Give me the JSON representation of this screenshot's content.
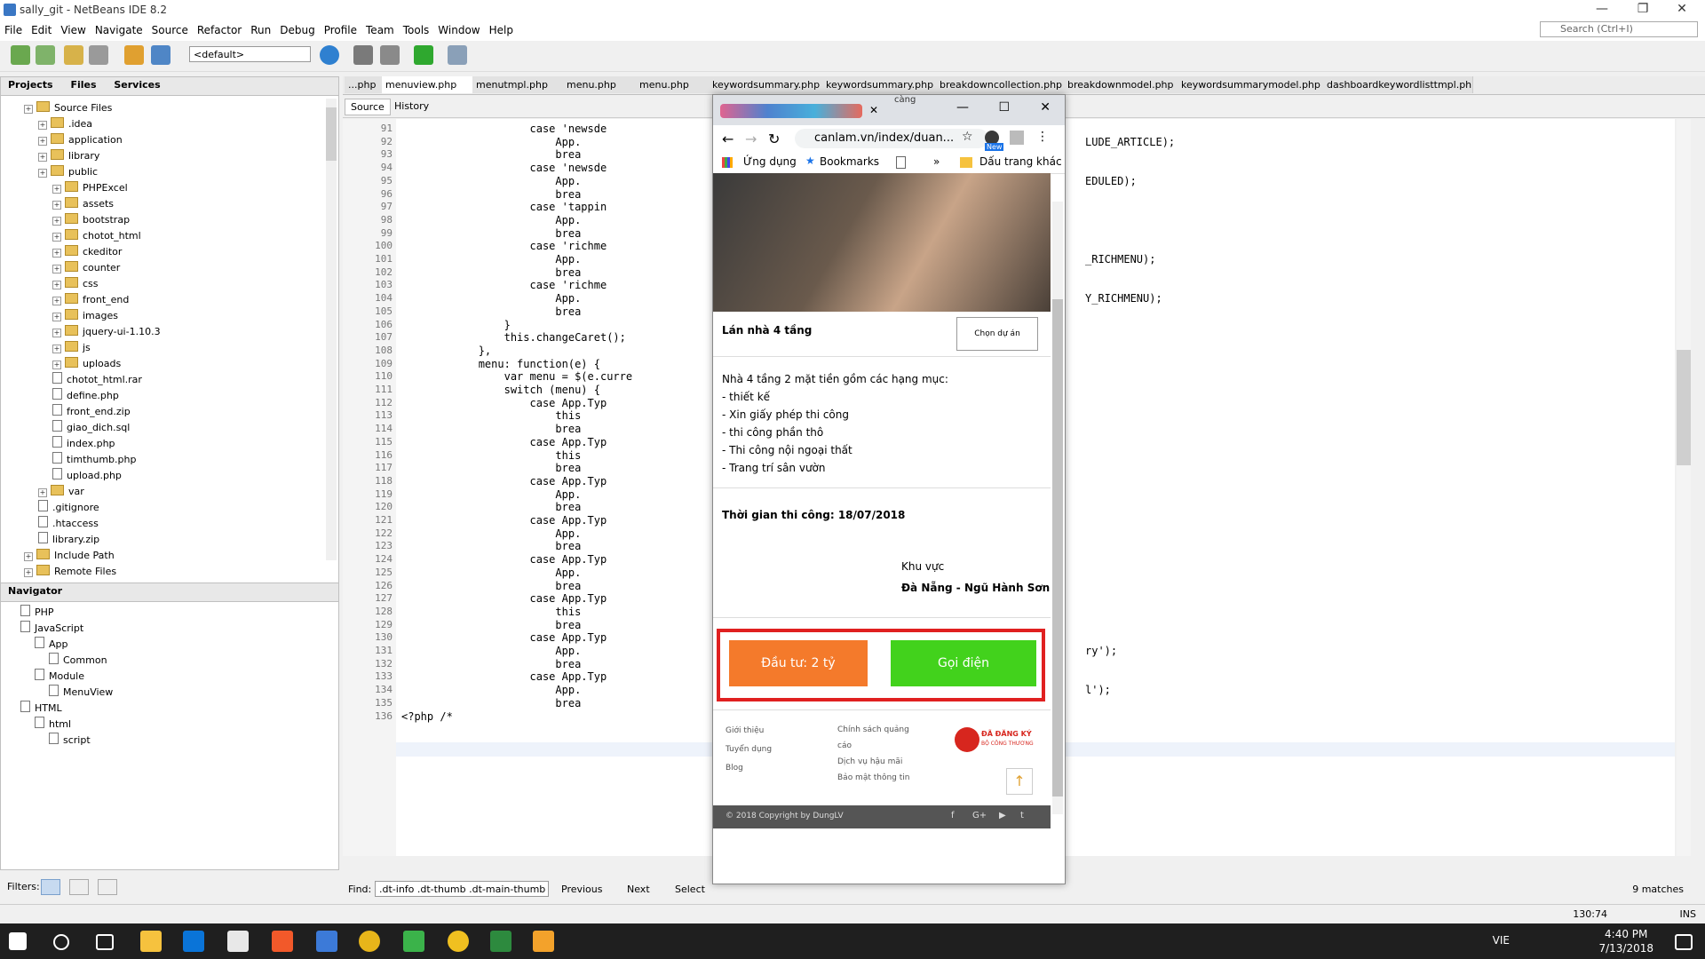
{
  "window": {
    "title": "sally_git - NetBeans IDE 8.2"
  },
  "menu": [
    "File",
    "Edit",
    "View",
    "Navigate",
    "Source",
    "Refactor",
    "Run",
    "Debug",
    "Profile",
    "Team",
    "Tools",
    "Window",
    "Help"
  ],
  "search": {
    "placeholder": "Search (Ctrl+I)"
  },
  "toolbar": {
    "config": "<default>"
  },
  "projects_panel": {
    "tabs": [
      "Projects",
      "Files",
      "Services"
    ],
    "tree": [
      {
        "label": "Source Files",
        "kind": "folder",
        "indent": 1
      },
      {
        "label": ".idea",
        "kind": "folder",
        "indent": 2
      },
      {
        "label": "application",
        "kind": "folder",
        "indent": 2
      },
      {
        "label": "library",
        "kind": "folder",
        "indent": 2
      },
      {
        "label": "public",
        "kind": "folder",
        "indent": 2
      },
      {
        "label": "PHPExcel",
        "kind": "folder",
        "indent": 3
      },
      {
        "label": "assets",
        "kind": "folder",
        "indent": 3
      },
      {
        "label": "bootstrap",
        "kind": "folder",
        "indent": 3
      },
      {
        "label": "chotot_html",
        "kind": "folder",
        "indent": 3
      },
      {
        "label": "ckeditor",
        "kind": "folder",
        "indent": 3
      },
      {
        "label": "counter",
        "kind": "folder",
        "indent": 3
      },
      {
        "label": "css",
        "kind": "folder",
        "indent": 3
      },
      {
        "label": "front_end",
        "kind": "folder",
        "indent": 3
      },
      {
        "label": "images",
        "kind": "folder",
        "indent": 3
      },
      {
        "label": "jquery-ui-1.10.3",
        "kind": "folder",
        "indent": 3
      },
      {
        "label": "js",
        "kind": "folder",
        "indent": 3
      },
      {
        "label": "uploads",
        "kind": "folder",
        "indent": 3
      },
      {
        "label": "chotot_html.rar",
        "kind": "file",
        "indent": 3
      },
      {
        "label": "define.php",
        "kind": "file",
        "indent": 3
      },
      {
        "label": "front_end.zip",
        "kind": "file",
        "indent": 3
      },
      {
        "label": "giao_dich.sql",
        "kind": "file",
        "indent": 3
      },
      {
        "label": "index.php",
        "kind": "file",
        "indent": 3
      },
      {
        "label": "timthumb.php",
        "kind": "file",
        "indent": 3
      },
      {
        "label": "upload.php",
        "kind": "file",
        "indent": 3
      },
      {
        "label": "var",
        "kind": "folder",
        "indent": 2
      },
      {
        "label": ".gitignore",
        "kind": "file",
        "indent": 2
      },
      {
        "label": ".htaccess",
        "kind": "file",
        "indent": 2
      },
      {
        "label": "library.zip",
        "kind": "file",
        "indent": 2
      },
      {
        "label": "Include Path",
        "kind": "folder",
        "indent": 1
      },
      {
        "label": "Remote Files",
        "kind": "folder",
        "indent": 1
      }
    ]
  },
  "navigator": {
    "title": "Navigator",
    "tree": [
      {
        "label": "PHP",
        "indent": 1
      },
      {
        "label": "JavaScript",
        "indent": 1
      },
      {
        "label": "App",
        "indent": 2
      },
      {
        "label": "Common",
        "indent": 3
      },
      {
        "label": "Module",
        "indent": 2
      },
      {
        "label": "MenuView",
        "indent": 3
      },
      {
        "label": "HTML",
        "indent": 1
      },
      {
        "label": "html",
        "indent": 2
      },
      {
        "label": "script",
        "indent": 3
      }
    ]
  },
  "filters_label": "Filters:",
  "editor": {
    "tabs": [
      "...php",
      "menuview.php",
      "menutmpl.php",
      "menu.php",
      "menu.php",
      "keywordsummary.php",
      "keywordsummary.php",
      "breakdowncollection.php",
      "breakdownmodel.php",
      "keywordsummarymodel.php",
      "dashboardkeywordlisttmpl.php..."
    ],
    "source_tab": "Source",
    "history_tab": "History",
    "lines": [
      {
        "n": "91",
        "code": "                    case 'newsde",
        "right": ""
      },
      {
        "n": "92",
        "code": "                        App.",
        "right": "LUDE_ARTICLE);"
      },
      {
        "n": "93",
        "code": "                        brea",
        "right": ""
      },
      {
        "n": "94",
        "code": "                    case 'newsde",
        "right": ""
      },
      {
        "n": "95",
        "code": "                        App.",
        "right": "EDULED);"
      },
      {
        "n": "96",
        "code": "                        brea",
        "right": ""
      },
      {
        "n": "97",
        "code": "                    case 'tappin",
        "right": ""
      },
      {
        "n": "98",
        "code": "                        App.",
        "right": ""
      },
      {
        "n": "99",
        "code": "                        brea",
        "right": ""
      },
      {
        "n": "100",
        "code": "                    case 'richme",
        "right": ""
      },
      {
        "n": "101",
        "code": "                        App.",
        "right": "_RICHMENU);"
      },
      {
        "n": "102",
        "code": "                        brea",
        "right": ""
      },
      {
        "n": "103",
        "code": "                    case 'richme",
        "right": ""
      },
      {
        "n": "104",
        "code": "                        App.",
        "right": "Y_RICHMENU);"
      },
      {
        "n": "105",
        "code": "                        brea",
        "right": ""
      },
      {
        "n": "106",
        "code": "                }",
        "right": ""
      },
      {
        "n": "107",
        "code": "                this.changeCaret();",
        "right": ""
      },
      {
        "n": "108",
        "code": "            },",
        "right": ""
      },
      {
        "n": "109",
        "code": "            menu: function(e) {",
        "right": ""
      },
      {
        "n": "110",
        "code": "                var menu = $(e.curre",
        "right": ""
      },
      {
        "n": "111",
        "code": "                switch (menu) {",
        "right": ""
      },
      {
        "n": "112",
        "code": "                    case App.Typ",
        "right": ""
      },
      {
        "n": "113",
        "code": "                        this",
        "right": ""
      },
      {
        "n": "114",
        "code": "                        brea",
        "right": ""
      },
      {
        "n": "115",
        "code": "                    case App.Typ",
        "right": ""
      },
      {
        "n": "116",
        "code": "                        this",
        "right": ""
      },
      {
        "n": "117",
        "code": "                        brea",
        "right": ""
      },
      {
        "n": "118",
        "code": "                    case App.Typ",
        "right": ""
      },
      {
        "n": "119",
        "code": "                        App.",
        "right": ""
      },
      {
        "n": "120",
        "code": "                        brea",
        "right": ""
      },
      {
        "n": "121",
        "code": "                    case App.Typ",
        "right": ""
      },
      {
        "n": "122",
        "code": "                        App.",
        "right": ""
      },
      {
        "n": "123",
        "code": "                        brea",
        "right": ""
      },
      {
        "n": "124",
        "code": "                    case App.Typ",
        "right": ""
      },
      {
        "n": "125",
        "code": "                        App.",
        "right": ""
      },
      {
        "n": "126",
        "code": "                        brea",
        "right": ""
      },
      {
        "n": "127",
        "code": "                    case App.Typ",
        "right": ""
      },
      {
        "n": "128",
        "code": "                        this",
        "right": ""
      },
      {
        "n": "129",
        "code": "                        brea",
        "right": ""
      },
      {
        "n": "130",
        "code": "                    case App.Typ",
        "right": ""
      },
      {
        "n": "131",
        "code": "                        App.",
        "right": "ry');"
      },
      {
        "n": "132",
        "code": "                        brea",
        "right": ""
      },
      {
        "n": "133",
        "code": "                    case App.Typ",
        "right": ""
      },
      {
        "n": "134",
        "code": "                        App.",
        "right": "l');"
      },
      {
        "n": "135",
        "code": "                        brea",
        "right": ""
      },
      {
        "n": "136",
        "code": "<?php /*",
        "right": ""
      }
    ]
  },
  "findbar": {
    "label": "Find:",
    "value": ".dt-info .dt-thumb .dt-main-thumb",
    "previous": "Previous",
    "next": "Next",
    "select": "Select",
    "matches": "9 matches"
  },
  "status": {
    "position": "130:74",
    "mode": "INS"
  },
  "browser": {
    "tab_title": "càng",
    "url": "canlam.vn/index/duan...",
    "bookmarks": {
      "apps": "Ứng dụng",
      "bookmarks": "Bookmarks",
      "more": "»",
      "other": "Dấu trang khác"
    },
    "ext_badge": "New",
    "project_title": "Lán nhà 4 tầng",
    "choose_label": "Chọn dự án",
    "description": [
      "Nhà 4 tầng 2 mặt tiền gồm các hạng mục:",
      "- thiết kế",
      "- Xin giấy phép thi công",
      "- thi công phần thô",
      "- Thi công nội ngoại thất",
      "- Trang trí sân vườn"
    ],
    "time_label": "Thời gian thi công: 18/07/2018",
    "region_label": "Khu vực",
    "region_value": "Đà Nẵng - Ngũ Hành Sơn",
    "invest_button": "Đầu tư: 2 tỷ",
    "call_button": "Gọi điện",
    "footer_col1": [
      "Giới thiệu",
      "Tuyển dụng",
      "Blog"
    ],
    "footer_col2": [
      "Chính sách quảng cáo",
      "Dịch vụ hậu mãi",
      "Bảo mật thông tin"
    ],
    "badge_text": "ĐÃ ĐĂNG KÝ",
    "badge_sub": "BỘ CÔNG THƯƠNG",
    "copyright": "© 2018 Copyright by DungLV"
  },
  "taskbar": {
    "time": "4:40 PM",
    "date": "7/13/2018",
    "lang": "VIE"
  },
  "colors": {
    "highlight_red": "#e02020",
    "invest": "#f47a2b",
    "call": "#42d21c"
  }
}
